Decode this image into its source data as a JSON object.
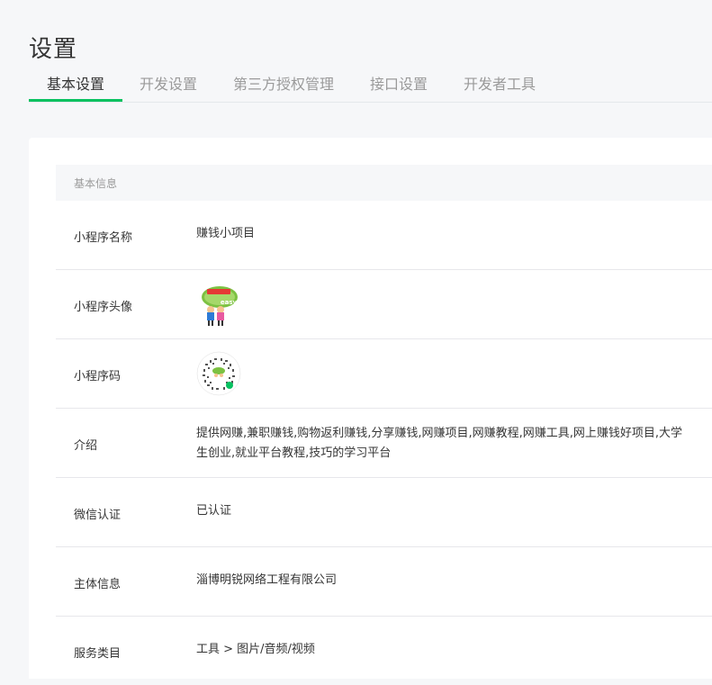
{
  "page": {
    "title": "设置"
  },
  "tabs": [
    {
      "label": "基本设置",
      "active": true
    },
    {
      "label": "开发设置",
      "active": false
    },
    {
      "label": "第三方授权管理",
      "active": false
    },
    {
      "label": "接口设置",
      "active": false
    },
    {
      "label": "开发者工具",
      "active": false
    }
  ],
  "colors": {
    "accent": "#07c160",
    "background": "#f6f7f9",
    "card": "#ffffff"
  },
  "basic_info": {
    "section_title": "基本信息",
    "rows": [
      {
        "label": "小程序名称",
        "value": "赚钱小项目"
      },
      {
        "label": "小程序头像",
        "value": ""
      },
      {
        "label": "小程序码",
        "value": ""
      },
      {
        "label": "介绍",
        "value": "提供网赚,兼职赚钱,购物返利赚钱,分享赚钱,网赚项目,网赚教程,网赚工具,网上赚钱好项目,大学生创业,就业平台教程,技巧的学习平台"
      },
      {
        "label": "微信认证",
        "value": "已认证"
      },
      {
        "label": "主体信息",
        "value": "淄博明锐网络工程有限公司"
      },
      {
        "label": "服务类目",
        "value": "工具 > 图片/音频/视频"
      }
    ]
  },
  "images": {
    "avatar_logo_text": "easy",
    "avatar_logo_sub": "赚钱小项目"
  }
}
